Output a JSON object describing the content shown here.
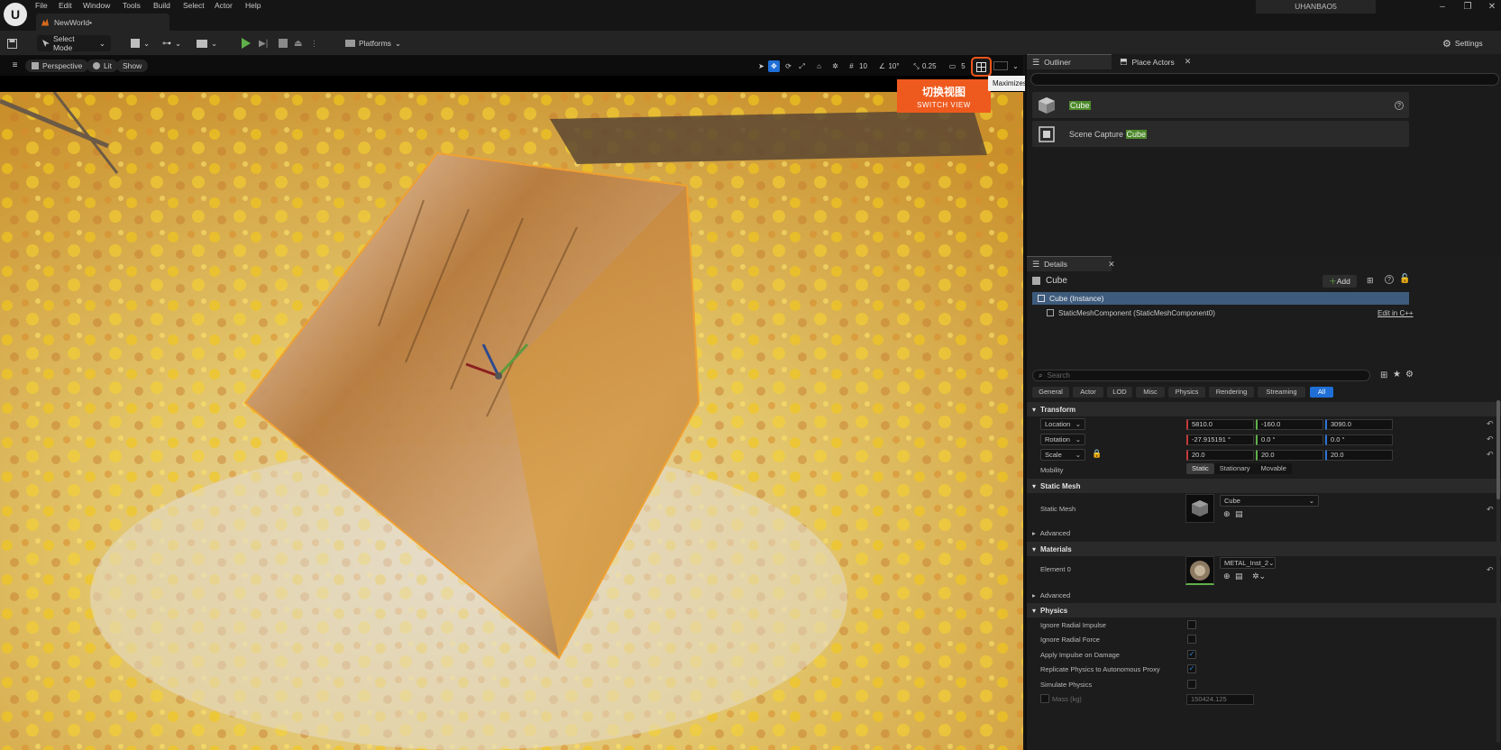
{
  "menubar": {
    "items": [
      "File",
      "Edit",
      "Window",
      "Tools",
      "Build",
      "Select",
      "Actor",
      "Help"
    ],
    "level_tab": "NewWorld•",
    "user": "UHANBAO5",
    "window_controls": [
      "–",
      "❐",
      "✕"
    ]
  },
  "toolbar": {
    "select_mode": "Select Mode",
    "platforms": "Platforms",
    "settings": "Settings"
  },
  "viewport": {
    "perspective": "Perspective",
    "lit": "Lit",
    "show": "Show",
    "grid_snap": "10",
    "rotation_snap": "10°",
    "scale_snap": "0.25",
    "camera_speed": "5"
  },
  "switch_view": {
    "zh": "切换视图",
    "en": "SWITCH VIEW",
    "tooltip": "Maximizes or restores this viewport"
  },
  "outliner": {
    "tab": "Outliner",
    "place_actors_tab": "Place Actors",
    "rows": [
      {
        "prefix": "",
        "match": "Cube",
        "suffix": ""
      },
      {
        "prefix": "Scene Capture ",
        "match": "Cube",
        "suffix": ""
      }
    ]
  },
  "details": {
    "tab": "Details",
    "actor_name": "Cube",
    "add_label": "Add",
    "instance": "Cube (Instance)",
    "component": "StaticMeshComponent (StaticMeshComponent0)",
    "edit_cpp": "Edit in C++",
    "search_placeholder": "Search",
    "filters": [
      "General",
      "Actor",
      "LOD",
      "Misc",
      "Physics",
      "Rendering",
      "Streaming",
      "All"
    ],
    "transform": {
      "title": "Transform",
      "location_label": "Location",
      "location": [
        "5810.0",
        "-160.0",
        "3090.0"
      ],
      "rotation_label": "Rotation",
      "rotation": [
        "-27.915191 °",
        "0.0 °",
        "0.0 °"
      ],
      "scale_label": "Scale",
      "scale": [
        "20.0",
        "20.0",
        "20.0"
      ],
      "mobility_label": "Mobility",
      "mobility_options": [
        "Static",
        "Stationary",
        "Movable"
      ]
    },
    "static_mesh": {
      "title": "Static Mesh",
      "label": "Static Mesh",
      "value": "Cube"
    },
    "advanced_label": "Advanced",
    "materials": {
      "title": "Materials",
      "element_label": "Element 0",
      "value": "METAL_Inst_2"
    },
    "physics": {
      "title": "Physics",
      "rows": [
        {
          "label": "Ignore Radial Impulse",
          "checked": false
        },
        {
          "label": "Ignore Radial Force",
          "checked": false
        },
        {
          "label": "Apply Impulse on Damage",
          "checked": true
        },
        {
          "label": "Replicate Physics to Autonomous Proxy",
          "checked": true
        },
        {
          "label": "Simulate Physics",
          "checked": false
        }
      ],
      "mass_label": "Mass (kg)",
      "mass_value": "150424.125"
    }
  },
  "colors": {
    "accent_blue": "#1f6fd6",
    "callout_orange": "#ee5a1e",
    "highlight_green": "#4d8a2a",
    "play_green": "#5fb04a"
  }
}
